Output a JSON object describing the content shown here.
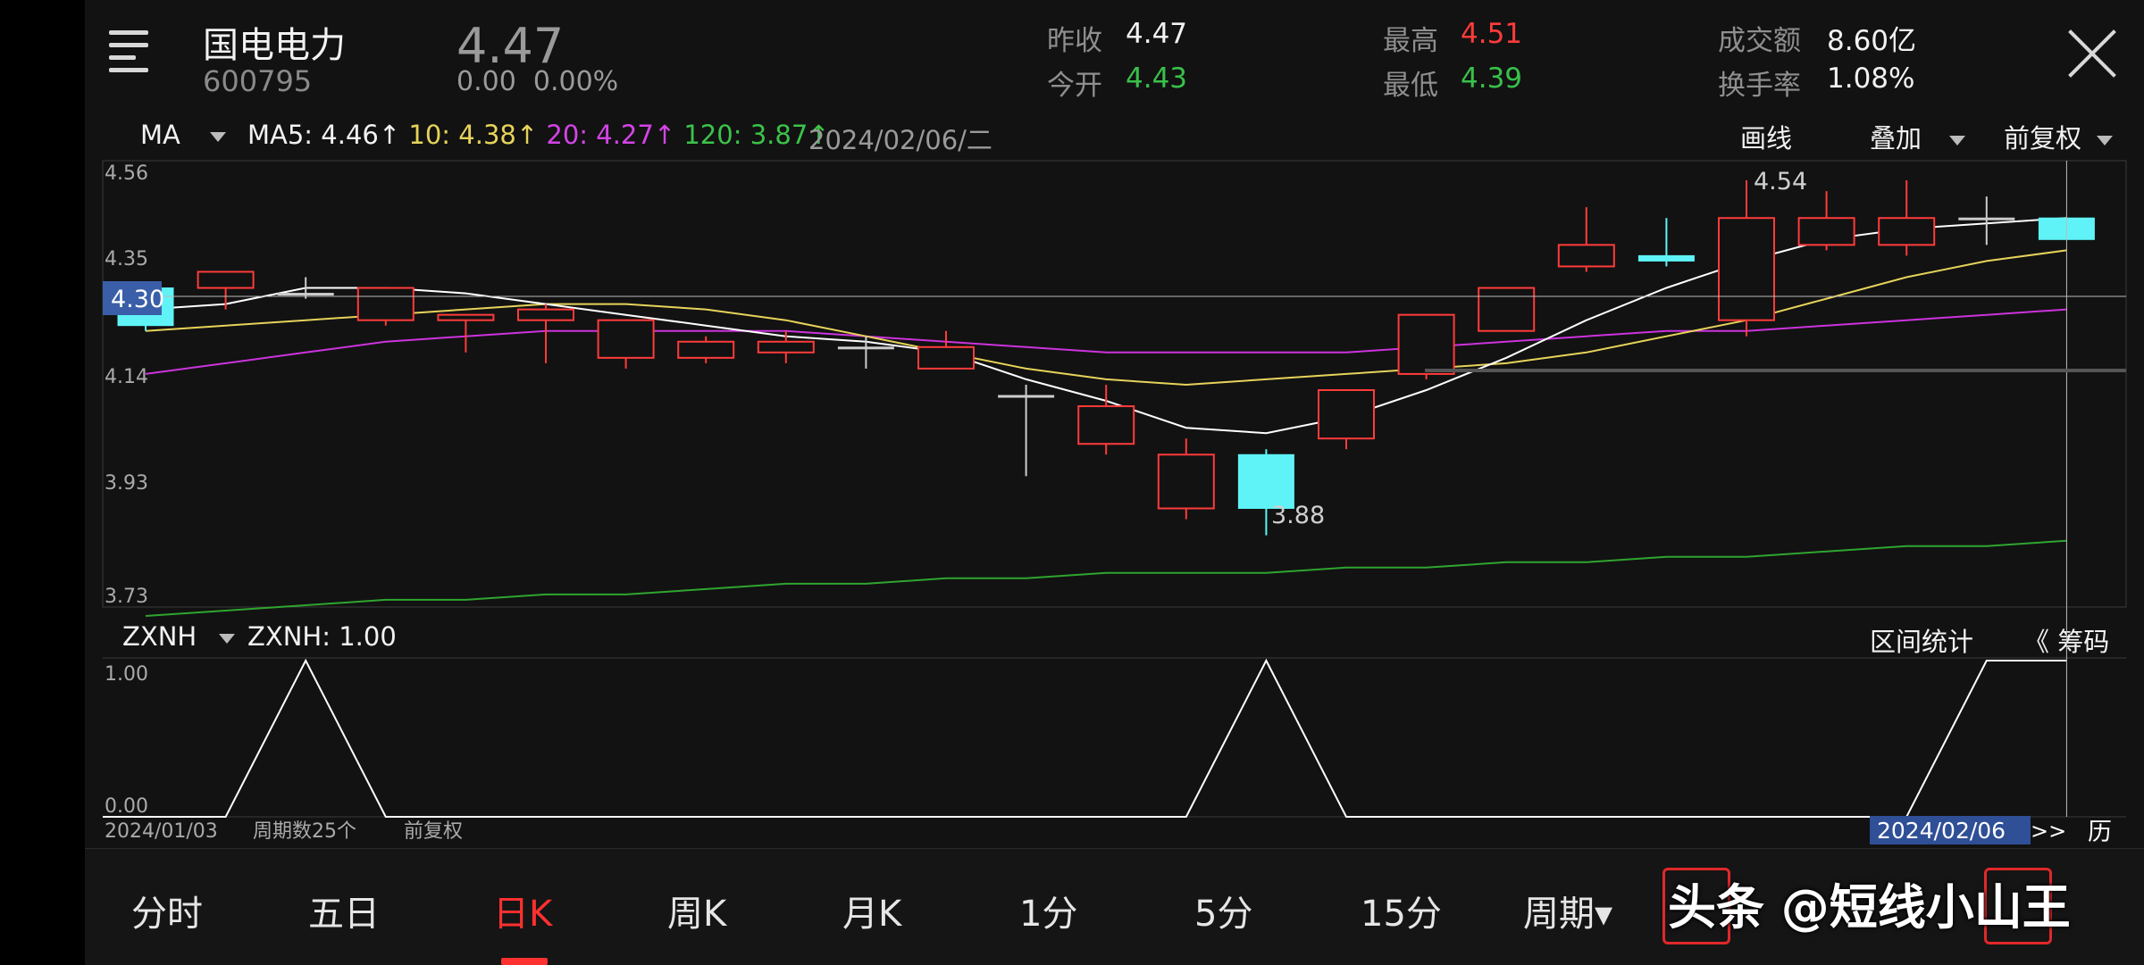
{
  "header": {
    "stock_name": "国电电力",
    "stock_code": "600795",
    "last_price": "4.47",
    "change": "0.00",
    "change_pct": "0.00%",
    "quotes": {
      "prev_close_label": "昨收",
      "prev_close": "4.47",
      "open_label": "今开",
      "open": "4.43",
      "high_label": "最高",
      "high": "4.51",
      "low_label": "最低",
      "low": "4.39",
      "turnover_amt_label": "成交额",
      "turnover_amt": "8.60亿",
      "turnover_rate_label": "换手率",
      "turnover_rate": "1.08%"
    }
  },
  "indicator_bar": {
    "indicator": "MA",
    "ma5": "MA5: 4.46↑",
    "ma10": "10: 4.38↑",
    "ma20": "20: 4.27↑",
    "ma120": "120: 3.87↑",
    "date": "2024/02/06/二",
    "draw_label": "画线",
    "overlay_label": "叠加",
    "adjust_label": "前复权"
  },
  "sub_bar": {
    "indicator": "ZXNH",
    "value": "ZXNH: 1.00",
    "range_stats_label": "区间统计",
    "chips_label": "《 筹码"
  },
  "footer": {
    "start_date": "2024/01/03",
    "periods": "周期数25个",
    "adjust": "前复权",
    "cursor_date": "2024/02/06",
    "cursor_arrow": ">>",
    "history_label": "历"
  },
  "tabs": [
    {
      "label": "分时"
    },
    {
      "label": "五日"
    },
    {
      "label": "日K"
    },
    {
      "label": "周K"
    },
    {
      "label": "月K"
    },
    {
      "label": "1分"
    },
    {
      "label": "5分"
    },
    {
      "label": "15分"
    },
    {
      "label": "周期▾"
    }
  ],
  "active_tab": "日K",
  "watermark": "头条 @短线小山王",
  "colors": {
    "up": "#ff3b3b",
    "down": "#5ff3f7",
    "ma5": "#ffffff",
    "ma10": "#e6d35a",
    "ma20": "#cc33dd",
    "ma120": "#2fa52f"
  },
  "chart_data": {
    "type": "candlestick",
    "ylim": [
      3.73,
      4.56
    ],
    "y_ticks": [
      "4.56",
      "4.35",
      "4.14",
      "3.93",
      "3.73"
    ],
    "cursor_price": "4.30",
    "high_label": "4.54",
    "low_label": "3.88",
    "candles": [
      {
        "o": 4.34,
        "c": 4.27,
        "h": 4.34,
        "l": 4.26
      },
      {
        "o": 4.34,
        "c": 4.37,
        "h": 4.37,
        "l": 4.3
      },
      {
        "o": 4.33,
        "c": 4.33,
        "h": 4.36,
        "l": 4.32
      },
      {
        "o": 4.28,
        "c": 4.34,
        "h": 4.34,
        "l": 4.27
      },
      {
        "o": 4.28,
        "c": 4.29,
        "h": 4.29,
        "l": 4.22
      },
      {
        "o": 4.28,
        "c": 4.3,
        "h": 4.31,
        "l": 4.2
      },
      {
        "o": 4.21,
        "c": 4.28,
        "h": 4.28,
        "l": 4.19
      },
      {
        "o": 4.21,
        "c": 4.24,
        "h": 4.25,
        "l": 4.2
      },
      {
        "o": 4.22,
        "c": 4.24,
        "h": 4.26,
        "l": 4.2
      },
      {
        "o": 4.23,
        "c": 4.23,
        "h": 4.25,
        "l": 4.19
      },
      {
        "o": 4.19,
        "c": 4.23,
        "h": 4.26,
        "l": 4.19
      },
      {
        "o": 4.14,
        "c": 4.14,
        "h": 4.16,
        "l": 3.99
      },
      {
        "o": 4.05,
        "c": 4.12,
        "h": 4.16,
        "l": 4.03
      },
      {
        "o": 3.93,
        "c": 4.03,
        "h": 4.06,
        "l": 3.91
      },
      {
        "o": 4.03,
        "c": 3.93,
        "h": 4.04,
        "l": 3.88
      },
      {
        "o": 4.06,
        "c": 4.15,
        "h": 4.15,
        "l": 4.04
      },
      {
        "o": 4.18,
        "c": 4.29,
        "h": 4.29,
        "l": 4.17
      },
      {
        "o": 4.26,
        "c": 4.34,
        "h": 4.34,
        "l": 4.26
      },
      {
        "o": 4.38,
        "c": 4.42,
        "h": 4.49,
        "l": 4.37
      },
      {
        "o": 4.4,
        "c": 4.39,
        "h": 4.47,
        "l": 4.38
      },
      {
        "o": 4.28,
        "c": 4.47,
        "h": 4.54,
        "l": 4.25
      },
      {
        "o": 4.42,
        "c": 4.47,
        "h": 4.52,
        "l": 4.41
      },
      {
        "o": 4.42,
        "c": 4.47,
        "h": 4.54,
        "l": 4.4
      },
      {
        "o": 4.47,
        "c": 4.47,
        "h": 4.51,
        "l": 4.42
      },
      {
        "o": 4.47,
        "c": 4.43,
        "h": 4.47,
        "l": 4.43
      }
    ],
    "ma5": [
      4.3,
      4.31,
      4.34,
      4.34,
      4.33,
      4.31,
      4.29,
      4.27,
      4.25,
      4.24,
      4.22,
      4.17,
      4.13,
      4.08,
      4.07,
      4.1,
      4.15,
      4.21,
      4.28,
      4.34,
      4.39,
      4.43,
      4.45,
      4.46,
      4.47
    ],
    "ma10": [
      4.26,
      4.27,
      4.28,
      4.29,
      4.3,
      4.31,
      4.31,
      4.3,
      4.28,
      4.25,
      4.22,
      4.19,
      4.17,
      4.16,
      4.17,
      4.18,
      4.19,
      4.2,
      4.22,
      4.25,
      4.28,
      4.32,
      4.36,
      4.39,
      4.41
    ],
    "ma20": [
      4.18,
      4.2,
      4.22,
      4.24,
      4.25,
      4.26,
      4.26,
      4.26,
      4.26,
      4.25,
      4.24,
      4.23,
      4.22,
      4.22,
      4.22,
      4.22,
      4.23,
      4.24,
      4.25,
      4.26,
      4.26,
      4.27,
      4.28,
      4.29,
      4.3
    ],
    "ma120": [
      3.73,
      3.74,
      3.75,
      3.76,
      3.76,
      3.77,
      3.77,
      3.78,
      3.79,
      3.79,
      3.8,
      3.8,
      3.81,
      3.81,
      3.81,
      3.82,
      3.82,
      3.83,
      3.83,
      3.84,
      3.84,
      3.85,
      3.86,
      3.86,
      3.87
    ],
    "zxnh": {
      "y_ticks": [
        "1.00",
        "0.00"
      ],
      "values": [
        0,
        0,
        1,
        0,
        0,
        0,
        0,
        0,
        0,
        0,
        0,
        0,
        0,
        0,
        1,
        0,
        0,
        0,
        0,
        0,
        0,
        0,
        0,
        1,
        1
      ]
    }
  }
}
